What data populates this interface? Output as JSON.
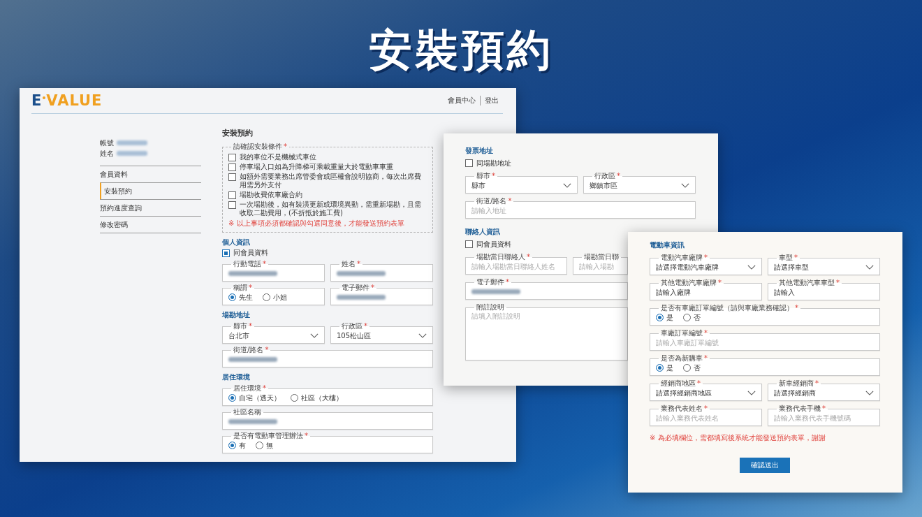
{
  "headline": "安裝預約",
  "windows": [
    {
      "logo": {
        "mark": "E",
        "word": "VALUE"
      },
      "nav": [
        "會員中心",
        "登出"
      ],
      "account": [
        {
          "label": "帳號",
          "redacted": true
        },
        {
          "label": "姓名",
          "redacted": true
        }
      ],
      "menu": [
        {
          "label": "會員資料",
          "selected": false
        },
        {
          "label": "安裝預約",
          "selected": true
        },
        {
          "label": "預約進度查詢",
          "selected": false
        },
        {
          "label": "修改密碼",
          "selected": false
        }
      ],
      "form_title": "安裝預約",
      "blocks": [
        {
          "kind": "conditions",
          "legend": "請確認安裝條件",
          "star": "*",
          "items": [
            {
              "label": "我的車位不是機械式車位",
              "checked": false
            },
            {
              "label": "停車場入口如為升降梯可乘載重量大於電動車車重",
              "checked": false
            },
            {
              "label": "如額外需要業務出席管委會或區權會說明協商，每次出席費用需另外支付",
              "checked": false
            },
            {
              "label": "場勘收費依車廠合約",
              "checked": false
            },
            {
              "label": "一次場勘後，如有裝潢更新或環境異動，需重新場勘，且需收取二勘費用，(不折抵於施工費)",
              "checked": false
            }
          ],
          "note": "※ 以上事項必須都確認與勾選同意後，才能發送預約表單"
        },
        {
          "kind": "section",
          "title": "個人資訊"
        },
        {
          "kind": "checkbox",
          "label": "同會員資料",
          "checked": true
        },
        {
          "kind": "fields",
          "fields": [
            {
              "kind": "input",
              "label": "行動電話",
              "star": "*",
              "redacted": true
            },
            {
              "kind": "input",
              "label": "姓名",
              "star": "*",
              "redacted": true
            }
          ]
        },
        {
          "kind": "fields",
          "fields": [
            {
              "kind": "radio",
              "label": "稱謂",
              "star": "*",
              "options": [
                {
                  "label": "先生",
                  "selected": true
                },
                {
                  "label": "小姐",
                  "selected": false
                }
              ]
            },
            {
              "kind": "input",
              "label": "電子郵件",
              "star": "*",
              "redacted": true
            }
          ]
        },
        {
          "kind": "section",
          "title": "場勘地址"
        },
        {
          "kind": "fields",
          "fields": [
            {
              "kind": "select",
              "label": "縣市",
              "star": "*",
              "value": "台北市"
            },
            {
              "kind": "select",
              "label": "行政區",
              "star": "*",
              "value": "105松山區"
            }
          ]
        },
        {
          "kind": "fields",
          "fields": [
            {
              "kind": "input",
              "label": "街道/路名",
              "star": "*",
              "redacted": true
            }
          ]
        },
        {
          "kind": "section",
          "title": "居住環境"
        },
        {
          "kind": "fields",
          "fields": [
            {
              "kind": "radio",
              "label": "居住環境",
              "star": "*",
              "options": [
                {
                  "label": "自宅（透天）",
                  "selected": true
                },
                {
                  "label": "社區（大樓）",
                  "selected": false
                }
              ]
            }
          ]
        },
        {
          "kind": "fields",
          "fields": [
            {
              "kind": "input",
              "label": "社區名稱",
              "redacted": true
            }
          ]
        },
        {
          "kind": "fields",
          "fields": [
            {
              "kind": "radio",
              "label": "是否有電動車管理辦法",
              "star": "*",
              "options": [
                {
                  "label": "有",
                  "selected": true
                },
                {
                  "label": "無",
                  "selected": false
                }
              ]
            }
          ]
        }
      ]
    },
    {
      "blocks": [
        {
          "kind": "section",
          "title": "發票地址"
        },
        {
          "kind": "checkbox",
          "label": "同場勘地址",
          "checked": false
        },
        {
          "kind": "fields",
          "fields": [
            {
              "kind": "select",
              "label": "縣市",
              "star": "*",
              "value": "縣市"
            },
            {
              "kind": "select",
              "label": "行政區",
              "star": "*",
              "value": "鄉鎮市區"
            }
          ]
        },
        {
          "kind": "fields",
          "fields": [
            {
              "kind": "input",
              "label": "街道/路名",
              "star": "*",
              "placeholder": "請輸入地址"
            }
          ]
        },
        {
          "kind": "section",
          "title": "聯絡人資訊"
        },
        {
          "kind": "checkbox",
          "label": "同會員資料",
          "checked": false
        },
        {
          "kind": "fields",
          "fields": [
            {
              "kind": "input",
              "label": "場勘當日聯絡人",
              "star": "*",
              "placeholder": "請輸入場勘當日聯絡人姓名"
            },
            {
              "kind": "input",
              "label": "場勘當日聯",
              "placeholder": "請輸入場勘"
            }
          ]
        },
        {
          "kind": "fields",
          "fields": [
            {
              "kind": "input",
              "label": "電子郵件",
              "star": "*",
              "redacted": true
            }
          ]
        },
        {
          "kind": "fields",
          "fields": [
            {
              "kind": "textarea",
              "label": "附註說明",
              "placeholder": "請填入附註說明"
            }
          ]
        }
      ]
    },
    {
      "blocks": [
        {
          "kind": "section",
          "title": "電動車資訊"
        },
        {
          "kind": "fields",
          "fields": [
            {
              "kind": "select",
              "label": "電動汽車廠牌",
              "star": "*",
              "value": "請選擇電動汽車廠牌"
            },
            {
              "kind": "select",
              "label": "車型",
              "star": "*",
              "value": "請選擇車型"
            }
          ]
        },
        {
          "kind": "fields",
          "fields": [
            {
              "kind": "input",
              "label": "其他電動汽車廠牌",
              "star": "*",
              "value": "請輸入廠牌"
            },
            {
              "kind": "input",
              "label": "其他電動汽車車型",
              "star": "*",
              "value": "請輸入"
            }
          ]
        },
        {
          "kind": "fields",
          "fields": [
            {
              "kind": "radio",
              "label": "是否有車廠訂單編號（請與車廠業務確認）",
              "star": "*",
              "options": [
                {
                  "label": "是",
                  "selected": true
                },
                {
                  "label": "否",
                  "selected": false
                }
              ]
            }
          ]
        },
        {
          "kind": "fields",
          "fields": [
            {
              "kind": "input",
              "label": "車廠訂單編號",
              "star": "*",
              "placeholder": "請輸入車廠訂單編號"
            }
          ]
        },
        {
          "kind": "fields",
          "fields": [
            {
              "kind": "radio",
              "label": "是否為新購車",
              "star": "*",
              "options": [
                {
                  "label": "是",
                  "selected": true
                },
                {
                  "label": "否",
                  "selected": false
                }
              ]
            }
          ]
        },
        {
          "kind": "fields",
          "fields": [
            {
              "kind": "select",
              "label": "經銷商地區",
              "star": "*",
              "value": "請選擇經銷商地區"
            },
            {
              "kind": "select",
              "label": "新車經銷商",
              "star": "*",
              "value": "請選擇經銷商"
            }
          ]
        },
        {
          "kind": "fields",
          "fields": [
            {
              "kind": "input",
              "label": "業務代表姓名",
              "star": "*",
              "placeholder": "請輸入業務代表姓名"
            },
            {
              "kind": "input",
              "label": "業務代表手機",
              "star": "*",
              "placeholder": "請輸入業務代表手機號碼"
            }
          ]
        },
        {
          "kind": "note",
          "text": "※ 為必填欄位，需都填寫後系統才能發送預約表單，謝謝"
        },
        {
          "kind": "button",
          "label": "確認送出"
        }
      ]
    }
  ]
}
